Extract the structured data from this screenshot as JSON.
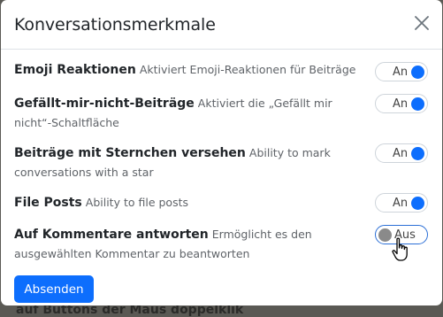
{
  "backdrop": {
    "text": "auf Buttons der Maus doppelklik"
  },
  "modal": {
    "title": "Konversationsmerkmale",
    "submit_label": "Absenden"
  },
  "features": [
    {
      "name": "Emoji Reaktionen",
      "desc": "Aktiviert Emoji-Reaktionen für Beiträge",
      "state": "An",
      "enabled": true
    },
    {
      "name": "Gefällt-mir-nicht-Beiträge",
      "desc": "Aktiviert die „Gefällt mir nicht“-Schaltfläche",
      "state": "An",
      "enabled": true
    },
    {
      "name": "Beiträge mit Sternchen versehen",
      "desc": "Ability to mark conversations with a star",
      "state": "An",
      "enabled": true
    },
    {
      "name": "File Posts",
      "desc": "Ability to file posts",
      "state": "An",
      "enabled": true
    },
    {
      "name": "Auf Kommentare antworten",
      "desc": "Ermöglicht es den ausgewählten Kommentar zu beantworten",
      "state": "Aus",
      "enabled": false
    }
  ],
  "icons": {
    "close": "close-icon",
    "cursor": "hand-pointer-cursor"
  },
  "colors": {
    "accent": "#0d6efd",
    "off_knob": "#8a8a8a"
  }
}
